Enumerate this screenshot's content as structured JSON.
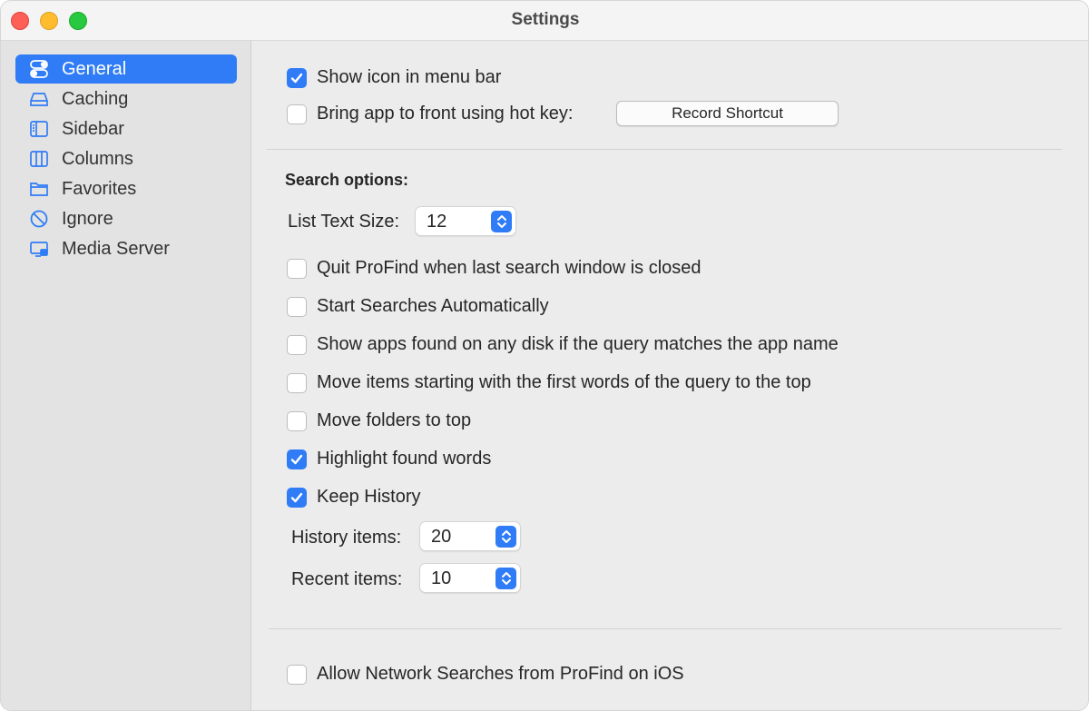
{
  "window": {
    "title": "Settings"
  },
  "sidebar": {
    "items": [
      {
        "label": "General",
        "icon": "toggles-icon",
        "active": true
      },
      {
        "label": "Caching",
        "icon": "drive-icon",
        "active": false
      },
      {
        "label": "Sidebar",
        "icon": "sidebar-icon",
        "active": false
      },
      {
        "label": "Columns",
        "icon": "columns-icon",
        "active": false
      },
      {
        "label": "Favorites",
        "icon": "folder-icon",
        "active": false
      },
      {
        "label": "Ignore",
        "icon": "prohibit-icon",
        "active": false
      },
      {
        "label": "Media Server",
        "icon": "display-icon",
        "active": false
      }
    ]
  },
  "general": {
    "show_icon_menu_bar": {
      "label": "Show icon in menu bar",
      "checked": true
    },
    "bring_app_front": {
      "label": "Bring app to front using hot key:",
      "checked": false
    },
    "record_shortcut_label": "Record Shortcut",
    "search_options_title": "Search options:",
    "list_text_size": {
      "label": "List Text Size:",
      "value": "12"
    },
    "options": [
      {
        "label": "Quit ProFind when last search window is closed",
        "checked": false
      },
      {
        "label": "Start Searches Automatically",
        "checked": false
      },
      {
        "label": "Show apps found on any disk if the query matches the app name",
        "checked": false
      },
      {
        "label": "Move items starting with the first words of the query to the top",
        "checked": false
      },
      {
        "label": "Move folders to top",
        "checked": false
      },
      {
        "label": "Highlight found words",
        "checked": true
      },
      {
        "label": "Keep History",
        "checked": true
      }
    ],
    "history_items": {
      "label": "History items:",
      "value": "20"
    },
    "recent_items": {
      "label": "Recent items:",
      "value": "10"
    },
    "allow_network": {
      "label": "Allow Network Searches from ProFind on iOS",
      "checked": false
    }
  },
  "colors": {
    "accent": "#2f7cf6",
    "sidebar_bg": "#e3e3e3",
    "content_bg": "#ececec"
  }
}
